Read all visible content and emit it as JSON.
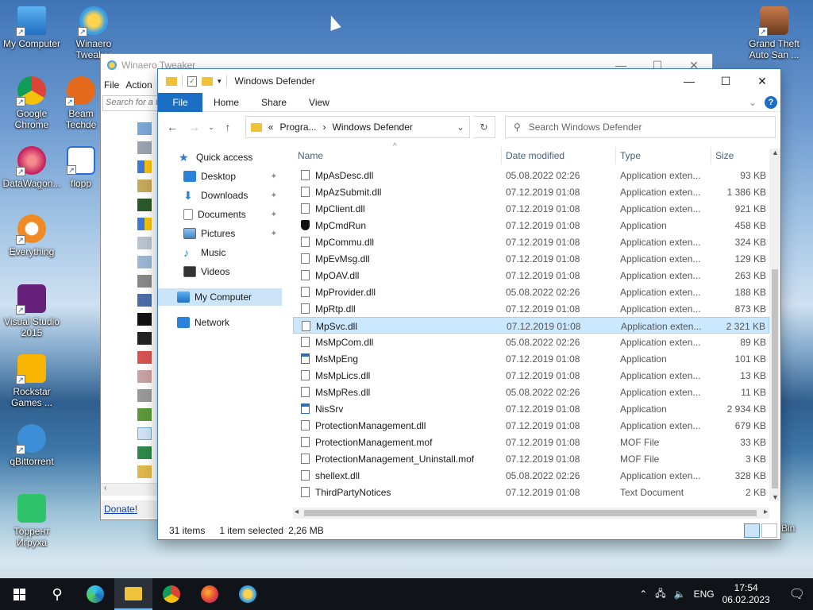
{
  "desktop": {
    "icons": [
      {
        "label": "My Computer"
      },
      {
        "label": "Winaero Tweaker"
      },
      {
        "label": "Google Chrome"
      },
      {
        "label": "Beam Techde"
      },
      {
        "label": "DataWagon..."
      },
      {
        "label": "flopp"
      },
      {
        "label": "Everything"
      },
      {
        "label": "Visual Studio 2015"
      },
      {
        "label": "Rockstar Games ..."
      },
      {
        "label": "qBittorrent"
      },
      {
        "label": "Торрент Игруха"
      },
      {
        "label": "Grand Theft Auto San ..."
      }
    ],
    "recycle_bin_partial": "Bin"
  },
  "back_window": {
    "title": "Winaero Tweaker",
    "menu": [
      "File",
      "Action"
    ],
    "search_placeholder": "Search for a t",
    "donate": "Donate!"
  },
  "explorer": {
    "title": "Windows Defender",
    "ribbon_tabs": [
      "File",
      "Home",
      "Share",
      "View"
    ],
    "path": {
      "ellipsis": "«",
      "parts": [
        "Progra...",
        "Windows Defender"
      ]
    },
    "search_placeholder": "Search Windows Defender",
    "nav": {
      "quick_access": "Quick access",
      "items": [
        {
          "label": "Desktop",
          "pinned": true
        },
        {
          "label": "Downloads",
          "pinned": true
        },
        {
          "label": "Documents",
          "pinned": true
        },
        {
          "label": "Pictures",
          "pinned": true
        },
        {
          "label": "Music",
          "pinned": false
        },
        {
          "label": "Videos",
          "pinned": false
        }
      ],
      "my_computer": "My Computer",
      "network": "Network"
    },
    "columns": {
      "name": "Name",
      "date": "Date modified",
      "type": "Type",
      "size": "Size"
    },
    "files": [
      {
        "name": "MpAsDesc.dll",
        "date": "05.08.2022 02:26",
        "type": "Application exten...",
        "size": "93 KB",
        "icon": "dll"
      },
      {
        "name": "MpAzSubmit.dll",
        "date": "07.12.2019 01:08",
        "type": "Application exten...",
        "size": "1 386 KB",
        "icon": "dll"
      },
      {
        "name": "MpClient.dll",
        "date": "07.12.2019 01:08",
        "type": "Application exten...",
        "size": "921 KB",
        "icon": "dll"
      },
      {
        "name": "MpCmdRun",
        "date": "07.12.2019 01:08",
        "type": "Application",
        "size": "458 KB",
        "icon": "shield"
      },
      {
        "name": "MpCommu.dll",
        "date": "07.12.2019 01:08",
        "type": "Application exten...",
        "size": "324 KB",
        "icon": "dll"
      },
      {
        "name": "MpEvMsg.dll",
        "date": "07.12.2019 01:08",
        "type": "Application exten...",
        "size": "129 KB",
        "icon": "dll"
      },
      {
        "name": "MpOAV.dll",
        "date": "07.12.2019 01:08",
        "type": "Application exten...",
        "size": "263 KB",
        "icon": "dll"
      },
      {
        "name": "MpProvider.dll",
        "date": "05.08.2022 02:26",
        "type": "Application exten...",
        "size": "188 KB",
        "icon": "dll"
      },
      {
        "name": "MpRtp.dll",
        "date": "07.12.2019 01:08",
        "type": "Application exten...",
        "size": "873 KB",
        "icon": "dll"
      },
      {
        "name": "MpSvc.dll",
        "date": "07.12.2019 01:08",
        "type": "Application exten...",
        "size": "2 321 KB",
        "icon": "dll",
        "selected": true
      },
      {
        "name": "MsMpCom.dll",
        "date": "05.08.2022 02:26",
        "type": "Application exten...",
        "size": "89 KB",
        "icon": "dll"
      },
      {
        "name": "MsMpEng",
        "date": "07.12.2019 01:08",
        "type": "Application",
        "size": "101 KB",
        "icon": "app"
      },
      {
        "name": "MsMpLics.dll",
        "date": "07.12.2019 01:08",
        "type": "Application exten...",
        "size": "13 KB",
        "icon": "dll"
      },
      {
        "name": "MsMpRes.dll",
        "date": "05.08.2022 02:26",
        "type": "Application exten...",
        "size": "11 KB",
        "icon": "dll"
      },
      {
        "name": "NisSrv",
        "date": "07.12.2019 01:08",
        "type": "Application",
        "size": "2 934 KB",
        "icon": "app"
      },
      {
        "name": "ProtectionManagement.dll",
        "date": "07.12.2019 01:08",
        "type": "Application exten...",
        "size": "679 KB",
        "icon": "dll"
      },
      {
        "name": "ProtectionManagement.mof",
        "date": "07.12.2019 01:08",
        "type": "MOF File",
        "size": "33 KB",
        "icon": "file"
      },
      {
        "name": "ProtectionManagement_Uninstall.mof",
        "date": "07.12.2019 01:08",
        "type": "MOF File",
        "size": "3 KB",
        "icon": "file"
      },
      {
        "name": "shellext.dll",
        "date": "05.08.2022 02:26",
        "type": "Application exten...",
        "size": "328 KB",
        "icon": "dll"
      },
      {
        "name": "ThirdPartyNotices",
        "date": "07.12.2019 01:08",
        "type": "Text Document",
        "size": "2 KB",
        "icon": "file"
      }
    ],
    "status": {
      "items": "31 items",
      "selected": "1 item selected",
      "size": "2,26 MB"
    }
  },
  "taskbar": {
    "language": "ENG",
    "time": "17:54",
    "date": "06.02.2023"
  },
  "colors": {
    "accent": "#1a6fc4",
    "selection": "#cce8ff"
  }
}
